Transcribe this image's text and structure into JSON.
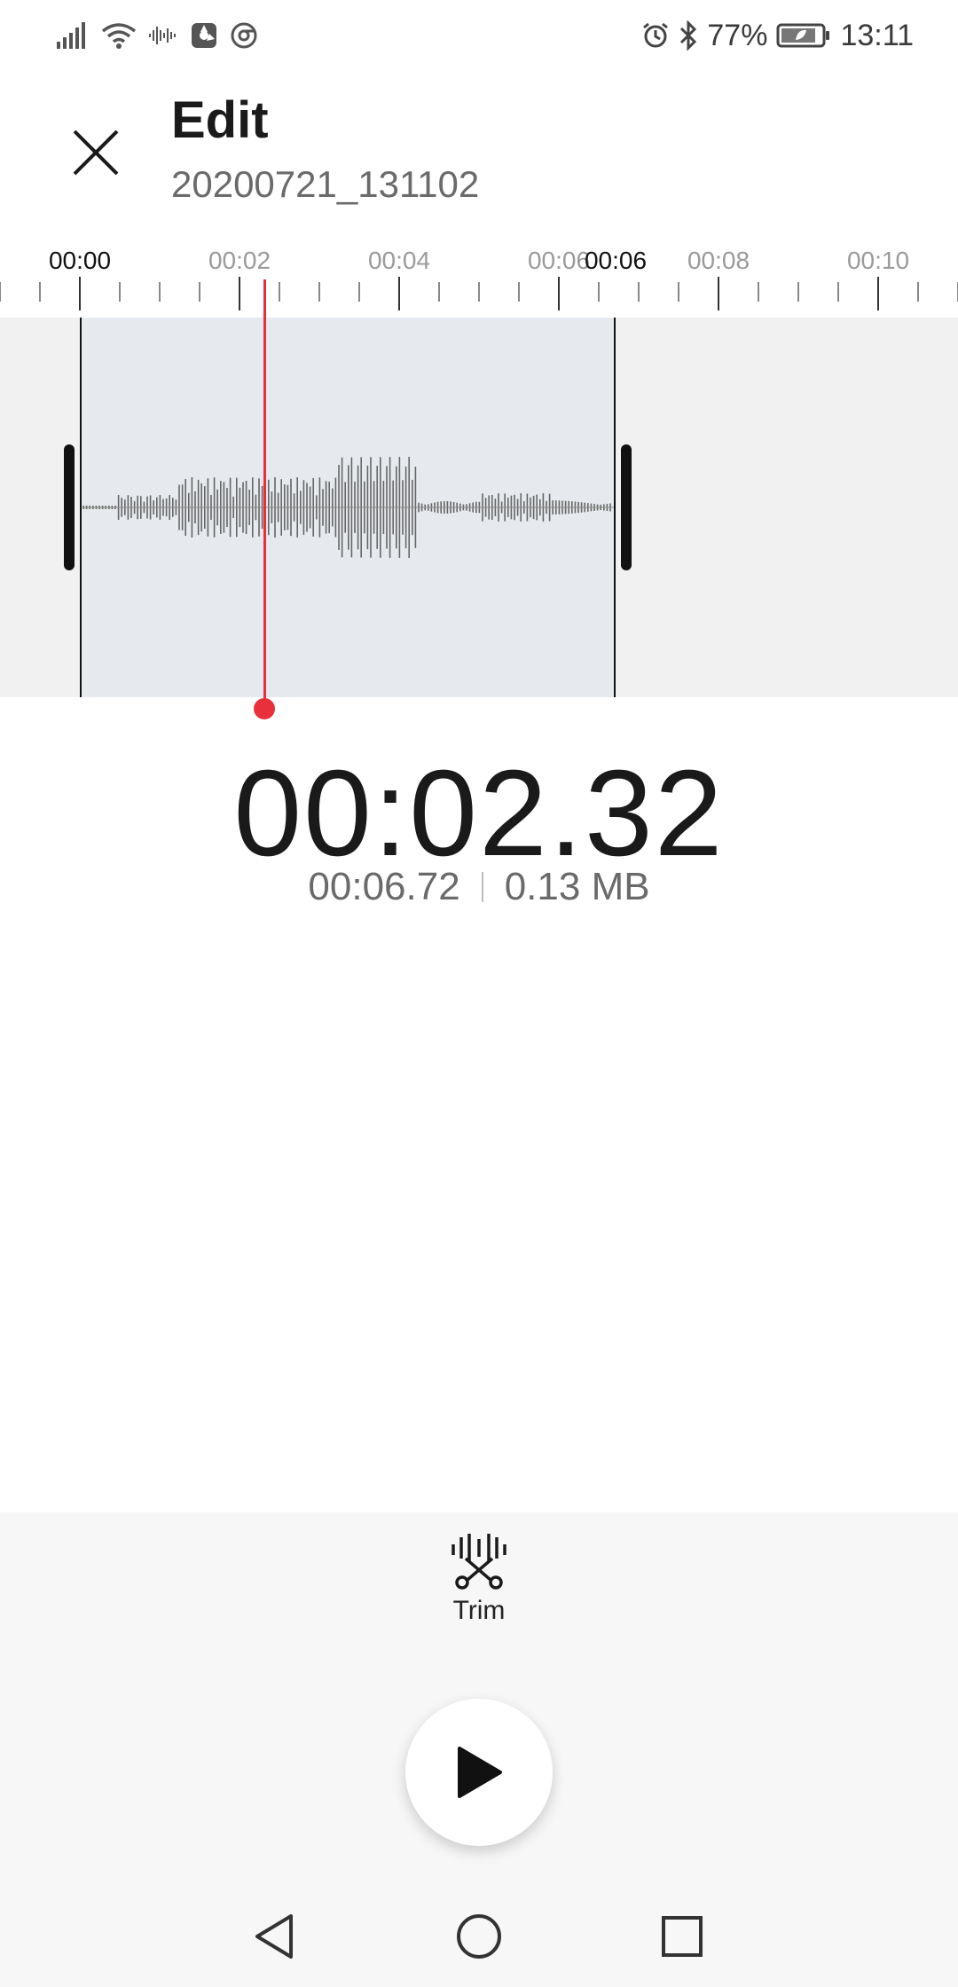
{
  "status_bar": {
    "battery_percent": "77%",
    "time": "13:11",
    "icons": [
      "signal-icon",
      "wifi-icon",
      "audio-wave-icon",
      "fan-icon",
      "chrome-icon",
      "alarm-icon",
      "bluetooth-icon",
      "battery-icon"
    ]
  },
  "header": {
    "title": "Edit",
    "filename": "20200721_131102"
  },
  "timeline": {
    "labels": [
      "00:00",
      "00:02",
      "00:04",
      "00:06",
      "00:06",
      "00:08",
      "00:10"
    ]
  },
  "playback": {
    "current_time": "00:02.32",
    "duration": "00:06.72",
    "file_size": "0.13 MB",
    "playhead_seconds": 2.32,
    "selection_start_seconds": 0,
    "selection_end_seconds": 6.72
  },
  "tools": {
    "trim_label": "Trim"
  },
  "colors": {
    "playhead": "#e8303a",
    "selection_bg": "#e6eaee",
    "track_bg": "#f1f1f1",
    "panel_bg": "#f7f7f7"
  }
}
